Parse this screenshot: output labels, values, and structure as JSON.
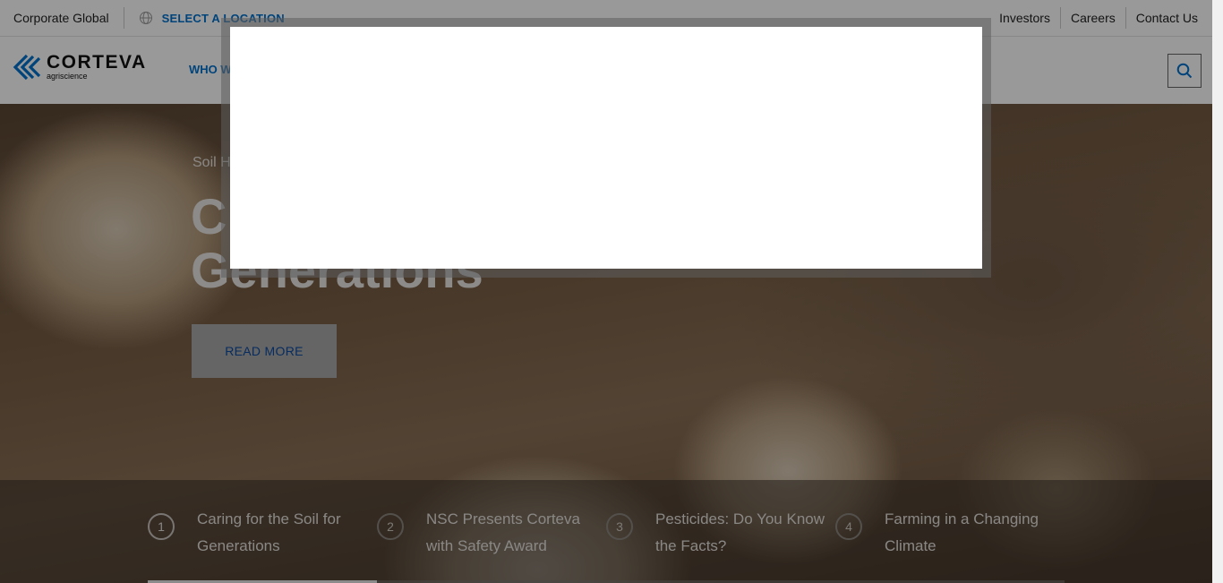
{
  "utility": {
    "corporate": "Corporate Global",
    "location_label": "SELECT A LOCATION",
    "links": [
      "Investors",
      "Careers",
      "Contact Us"
    ]
  },
  "nav": {
    "logo_title": "CORTEVA",
    "logo_sub": "agriscience",
    "who_we_label": "WHO W",
    "search_icon": "search-icon"
  },
  "hero": {
    "eyebrow": "Soil H",
    "title_line1": "C",
    "title_line2": "Generations",
    "cta": "READ MORE"
  },
  "carousel": {
    "items": [
      {
        "num": "1",
        "label": "Caring for the Soil for Generations"
      },
      {
        "num": "2",
        "label": "NSC Presents Corteva with Safety Award"
      },
      {
        "num": "3",
        "label": "Pesticides: Do You Know the Facts?"
      },
      {
        "num": "4",
        "label": "Farming in a Changing Climate"
      }
    ],
    "active_fraction": 0.25
  },
  "colors": {
    "brand_blue": "#0072ce",
    "cta_text": "#0d4a9e"
  }
}
